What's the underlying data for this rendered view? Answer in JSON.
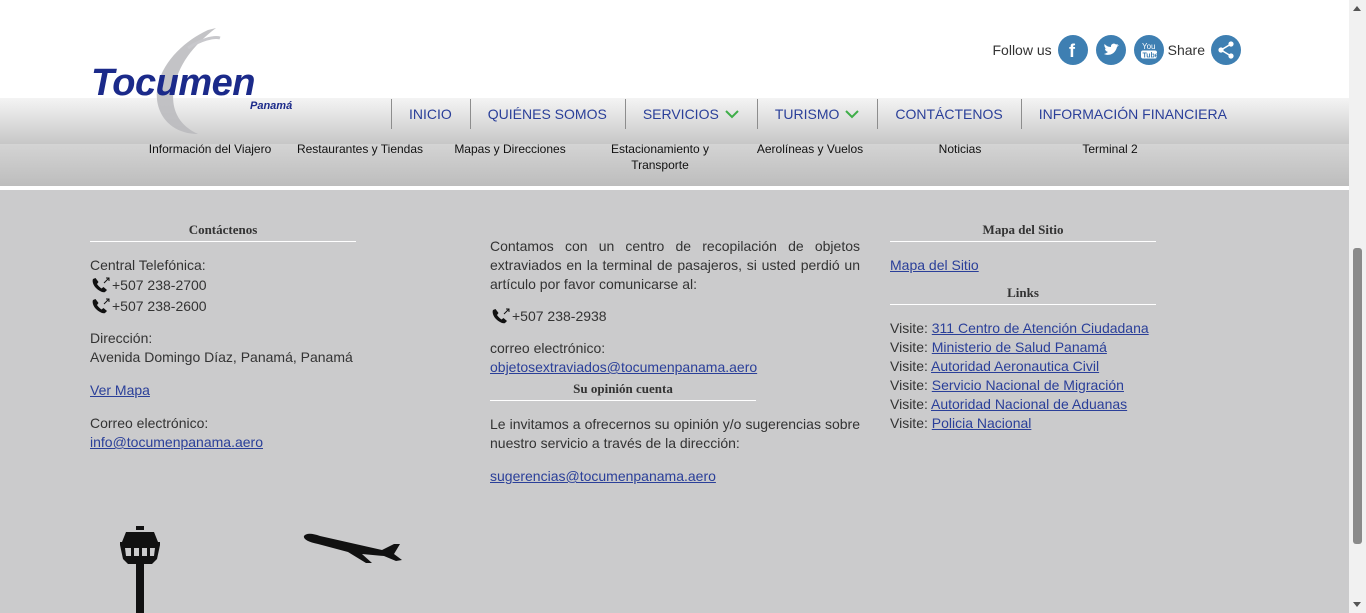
{
  "brand": {
    "name": "Tocumen",
    "sub": "Panamá"
  },
  "social": {
    "follow_label": "Follow us",
    "share_label": "Share"
  },
  "nav": {
    "items": [
      {
        "label": "INICIO",
        "dropdown": false
      },
      {
        "label": "QUIÉNES SOMOS",
        "dropdown": false
      },
      {
        "label": "SERVICIOS",
        "dropdown": true
      },
      {
        "label": "TURISMO",
        "dropdown": true
      },
      {
        "label": "CONTÁCTENOS",
        "dropdown": false
      },
      {
        "label": "INFORMACIÓN FINANCIERA",
        "dropdown": false
      }
    ],
    "chevron_color": "#3fae49"
  },
  "subnav": {
    "items": [
      "Información del Viajero",
      "Restaurantes y Tiendas",
      "Mapas y Direcciones",
      "Estacionamiento y Transporte",
      "Aerolíneas y Vuelos",
      "Noticias",
      "Terminal 2"
    ]
  },
  "footer": {
    "contact": {
      "heading": "Contáctenos",
      "central_label": "Central Telefónica:",
      "phones": [
        "+507 238-2700",
        "+507 238-2600"
      ],
      "address_label": "Dirección:",
      "address": "Avenida Domingo Díaz, Panamá, Panamá",
      "map_link": "Ver Mapa",
      "email_label": "Correo electrónico:",
      "email": "info@tocumenpanama.aero"
    },
    "lost": {
      "text": "Contamos con un centro de recopilación de objetos extraviados en la terminal de pasajeros, si usted perdió un artículo por favor comunicarse al:",
      "phone": "+507 238-2938",
      "email_label": "correo electrónico:",
      "email": "objetosextraviados@tocumenpanama.aero",
      "opinion_heading": "Su opinión cuenta",
      "opinion_text": "Le invitamos a ofrecernos su opinión y/o sugerencias sobre nuestro servicio a través de la dirección:",
      "opinion_email": "sugerencias@tocumenpanama.aero"
    },
    "sitemap": {
      "heading": "Mapa del Sitio",
      "link": "Mapa del Sitio",
      "links_heading": "Links",
      "visit_prefix": "Visite:",
      "links": [
        "311 Centro de Atención Ciudadana",
        "Ministerio de Salud Panamá",
        "Autoridad Aeronautica Civil",
        "Servicio Nacional de Migración",
        "Autoridad Nacional de Aduanas",
        "Policia Nacional"
      ]
    }
  },
  "icons": {
    "facebook": "facebook-icon",
    "twitter": "twitter-icon",
    "youtube": "youtube-icon",
    "share": "share-icon",
    "phone": "phone-icon",
    "tower": "control-tower-icon",
    "plane": "airplane-icon"
  },
  "colors": {
    "link": "#2a3f99",
    "social": "#3e7fb2",
    "brand": "#1b2a8a"
  }
}
